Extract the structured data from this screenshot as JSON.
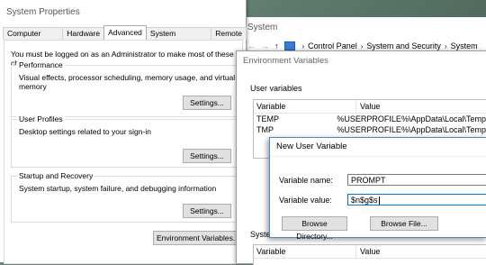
{
  "desktop": {},
  "system_properties": {
    "title": "System Properties",
    "tabs": [
      "Computer Name",
      "Hardware",
      "Advanced",
      "System Protection",
      "Remote"
    ],
    "active_tab": "Advanced",
    "admin_note": "You must be logged on as an Administrator to make most of these changes.",
    "performance": {
      "title": "Performance",
      "desc": "Visual effects, processor scheduling, memory usage, and virtual memory",
      "button": "Settings..."
    },
    "user_profiles": {
      "title": "User Profiles",
      "desc": "Desktop settings related to your sign-in",
      "button": "Settings..."
    },
    "startup_recovery": {
      "title": "Startup and Recovery",
      "desc": "System startup, system failure, and debugging information",
      "button": "Settings..."
    },
    "env_button": "Environment Variables..."
  },
  "system_window": {
    "title": "System",
    "breadcrumb": [
      "Control Panel",
      "System and Security",
      "System"
    ]
  },
  "environment_variables": {
    "title": "Environment Variables",
    "user_label": "User variables",
    "columns": [
      "Variable",
      "Value"
    ],
    "user_rows": [
      {
        "var": "TEMP",
        "val": "%USERPROFILE%\\AppData\\Local\\Temp"
      },
      {
        "var": "TMP",
        "val": "%USERPROFILE%\\AppData\\Local\\Temp"
      }
    ],
    "system_label": "System",
    "system_columns": [
      "Variable",
      "Value"
    ]
  },
  "new_user_variable": {
    "title": "New User Variable",
    "name_label": "Variable name:",
    "name_value": "PROMPT",
    "value_label": "Variable value:",
    "value_value": "$n$g$s",
    "browse_dir": "Browse Directory...",
    "browse_file": "Browse File..."
  }
}
